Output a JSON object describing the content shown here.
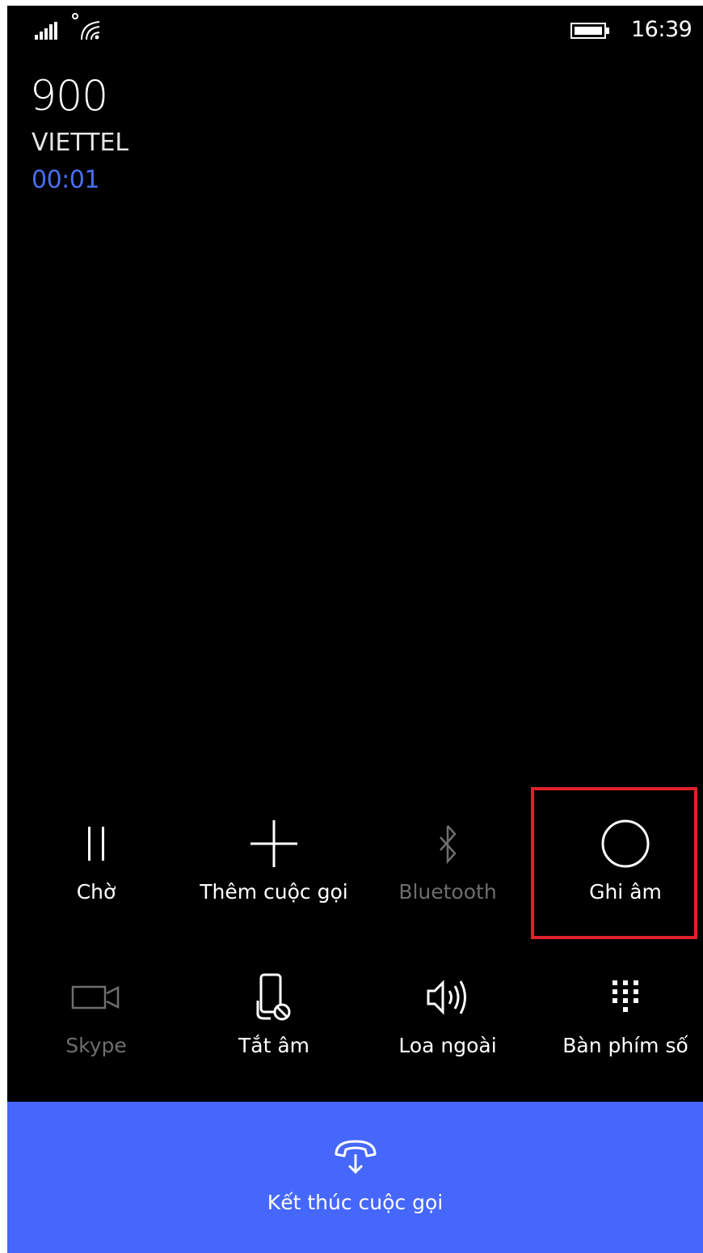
{
  "status_bar": {
    "time": "16:39",
    "icons": [
      "signal-icon",
      "wifi-icon",
      "battery-icon"
    ]
  },
  "call": {
    "number": "900",
    "carrier": "VIETTEL",
    "duration": "00:01"
  },
  "controls": {
    "row1": [
      {
        "id": "hold",
        "label": "Chờ",
        "icon": "pause-icon",
        "enabled": true
      },
      {
        "id": "add_call",
        "label": "Thêm cuộc gọi",
        "icon": "plus-icon",
        "enabled": true
      },
      {
        "id": "bluetooth",
        "label": "Bluetooth",
        "icon": "bluetooth-icon",
        "enabled": false
      },
      {
        "id": "record",
        "label": "Ghi âm",
        "icon": "record-circle-icon",
        "enabled": true,
        "highlighted": true
      }
    ],
    "row2": [
      {
        "id": "skype",
        "label": "Skype",
        "icon": "video-camera-icon",
        "enabled": false
      },
      {
        "id": "mute",
        "label": "Tắt âm",
        "icon": "mute-phone-icon",
        "enabled": true
      },
      {
        "id": "speaker",
        "label": "Loa ngoài",
        "icon": "speaker-icon",
        "enabled": true
      },
      {
        "id": "keypad",
        "label": "Bàn phím số",
        "icon": "keypad-icon",
        "enabled": true
      }
    ]
  },
  "end_call": {
    "label": "Kết thúc cuộc gọi",
    "icon": "hang-up-icon"
  },
  "colors": {
    "background": "#000000",
    "accent": "#4667fb",
    "timer": "#4a6ef0",
    "highlight": "#e0202a",
    "disabled": "#6e6e6e"
  }
}
